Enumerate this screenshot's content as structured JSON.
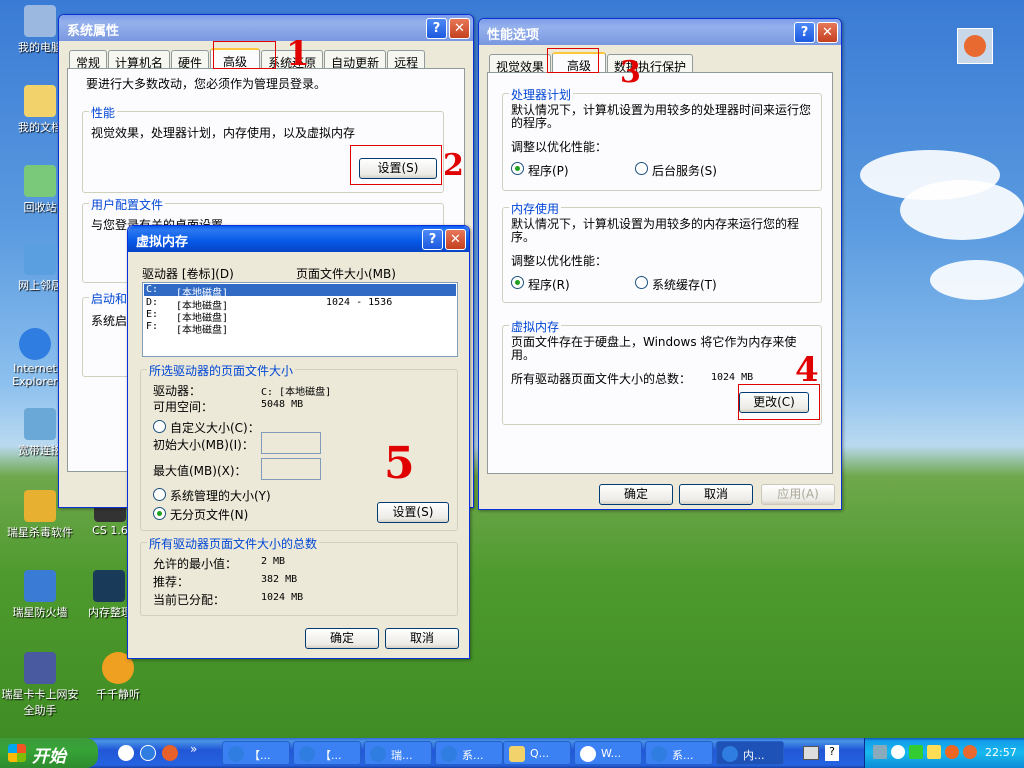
{
  "desktop": {
    "icons": [
      {
        "label": "我的电脑"
      },
      {
        "label": "我的文档"
      },
      {
        "label": "回收站"
      },
      {
        "label": "网上邻居"
      },
      {
        "label": "Internet Explorer"
      },
      {
        "label": "宽带连接"
      },
      {
        "label": "瑞星杀毒软件"
      },
      {
        "label": "CS 1.6"
      },
      {
        "label": "瑞星防火墙"
      },
      {
        "label": "内存整理"
      },
      {
        "label": "瑞星卡卡上网安全助手"
      },
      {
        "label": "千千静听"
      }
    ]
  },
  "sysprop": {
    "title": "系统属性",
    "tabs": [
      "常规",
      "计算机名",
      "硬件",
      "高级",
      "系统还原",
      "自动更新",
      "远程"
    ],
    "admin_note": "要进行大多数改动，您必须作为管理员登录。",
    "perf_group": "性能",
    "perf_desc": "视觉效果，处理器计划，内存使用，以及虚拟内存",
    "perf_settings_btn": "设置(S)",
    "profile_group": "用户配置文件",
    "profile_desc": "与您登录有关的桌面设置",
    "startup_group": "启动和",
    "startup_desc": "系统启"
  },
  "perfopts": {
    "title": "性能选项",
    "tabs": [
      "视觉效果",
      "高级",
      "数据执行保护"
    ],
    "cpu_group": "处理器计划",
    "cpu_desc": "默认情况下，计算机设置为用较多的处理器时间来运行您的程序。",
    "cpu_adjust": "调整以优化性能：",
    "cpu_opt1": "程序(P)",
    "cpu_opt2": "后台服务(S)",
    "mem_group": "内存使用",
    "mem_desc": "默认情况下，计算机设置为用较多的内存来运行您的程序。",
    "mem_adjust": "调整以优化性能：",
    "mem_opt1": "程序(R)",
    "mem_opt2": "系统缓存(T)",
    "vm_group": "虚拟内存",
    "vm_desc": "页面文件存在于硬盘上，Windows 将它作为内存来使用。",
    "vm_total_label": "所有驱动器页面文件大小的总数：",
    "vm_total_value": "1024 MB",
    "vm_change_btn": "更改(C)",
    "ok": "确定",
    "cancel": "取消",
    "apply": "应用(A)"
  },
  "vmem": {
    "title": "虚拟内存",
    "col_drive": "驱动器 [卷标](D)",
    "col_size": "页面文件大小(MB)",
    "drives": [
      {
        "drive": "C:",
        "label": "[本地磁盘]",
        "size": ""
      },
      {
        "drive": "D:",
        "label": "[本地磁盘]",
        "size": "1024 - 1536"
      },
      {
        "drive": "E:",
        "label": "[本地磁盘]",
        "size": ""
      },
      {
        "drive": "F:",
        "label": "[本地磁盘]",
        "size": ""
      }
    ],
    "sel_group": "所选驱动器的页面文件大小",
    "drive_label": "驱动器：",
    "drive_value": "C:  [本地磁盘]",
    "free_label": "可用空间：",
    "free_value": "5048 MB",
    "custom_size": "自定义大小(C)：",
    "initial_label": "初始大小(MB)(I)：",
    "max_label": "最大值(MB)(X)：",
    "system_managed": "系统管理的大小(Y)",
    "no_paging": "无分页文件(N)",
    "set_btn": "设置(S)",
    "total_group": "所有驱动器页面文件大小的总数",
    "min_label": "允许的最小值：",
    "min_value": "2 MB",
    "rec_label": "推荐：",
    "rec_value": "382 MB",
    "cur_label": "当前已分配：",
    "cur_value": "1024 MB",
    "ok": "确定",
    "cancel": "取消"
  },
  "annotations": [
    "1",
    "2",
    "3",
    "4",
    "5"
  ],
  "taskbar": {
    "start": "开始",
    "items": [
      "【...",
      "【...",
      "瑞...",
      "系...",
      "Q...",
      "W...",
      "系...",
      "内..."
    ],
    "clock": "22:57"
  },
  "colors": {
    "title_active": "#0a5cf5",
    "title_inactive": "#7d9ce8",
    "annotation": "#e00000",
    "group_title": "#0046d5"
  }
}
